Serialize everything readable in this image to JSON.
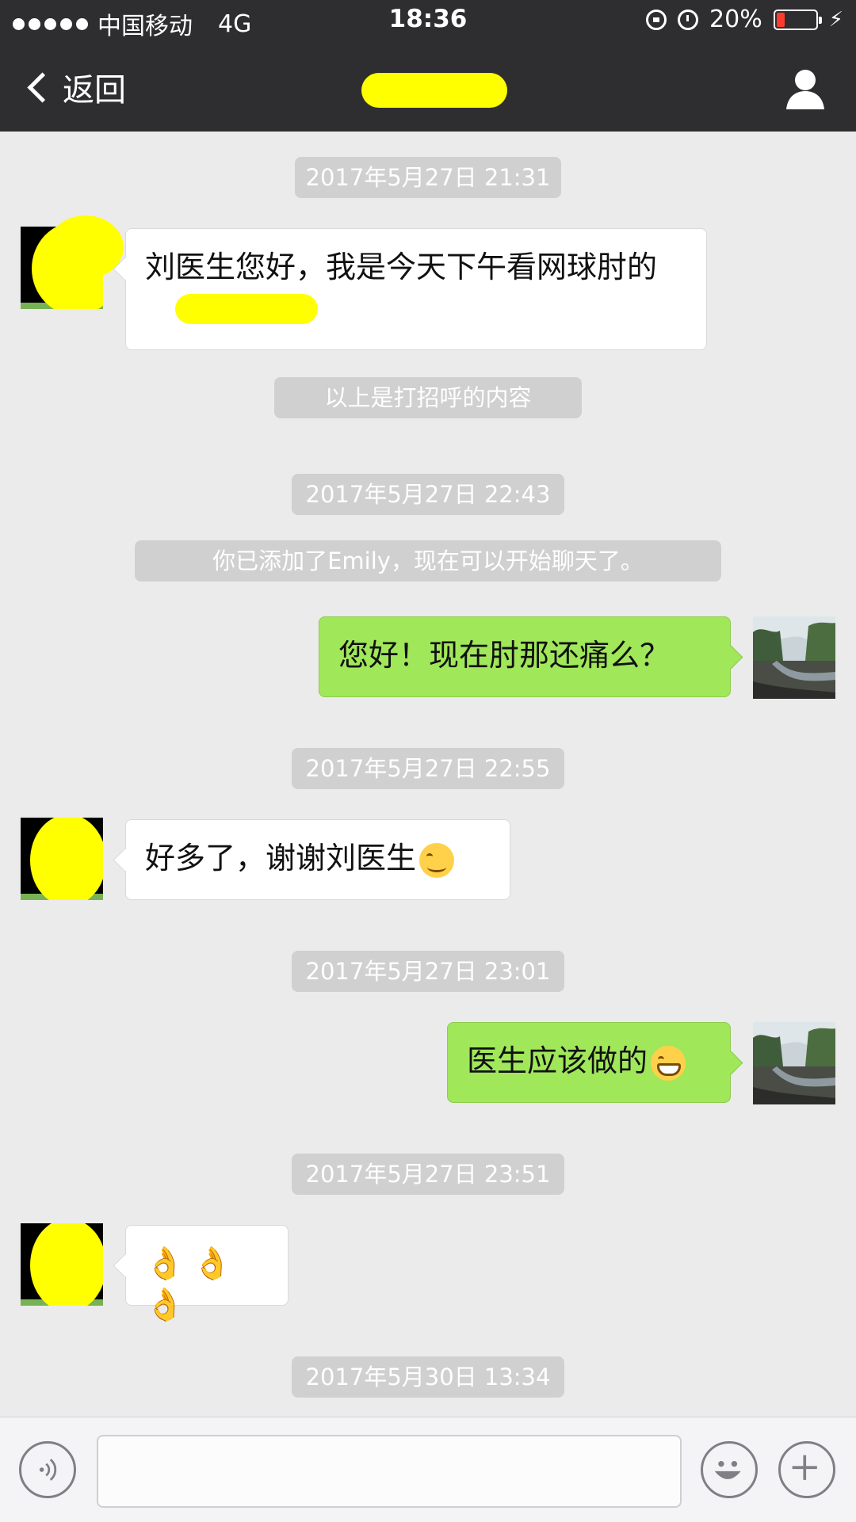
{
  "status_bar": {
    "carrier": "中国移动",
    "network": "4G",
    "time": "18:36",
    "battery_percent": "20%",
    "battery_level": 0.2,
    "icons": [
      "signal-dots-icon",
      "rotation-lock-icon",
      "alarm-icon",
      "battery-icon",
      "charging-bolt-icon"
    ]
  },
  "nav": {
    "back_label": "返回",
    "title": "",
    "profile_icon": "person-icon"
  },
  "messages": [
    {
      "kind": "time",
      "text": "2017年5月27日 21:31"
    },
    {
      "kind": "in",
      "text": "刘医生您好，我是今天下午看网球肘的"
    },
    {
      "kind": "system",
      "text": "以上是打招呼的内容"
    },
    {
      "kind": "time",
      "text": "2017年5月27日 22:43"
    },
    {
      "kind": "system",
      "text": "你已添加了Emily，现在可以开始聊天了。"
    },
    {
      "kind": "out",
      "text": "您好！现在肘那还痛么？"
    },
    {
      "kind": "time",
      "text": "2017年5月27日 22:55"
    },
    {
      "kind": "in",
      "text": "好多了，谢谢刘医生"
    },
    {
      "kind": "time",
      "text": "2017年5月27日 23:01"
    },
    {
      "kind": "out",
      "text": "医生应该做的"
    },
    {
      "kind": "time",
      "text": "2017年5月27日 23:51"
    },
    {
      "kind": "in",
      "text": ""
    },
    {
      "kind": "time",
      "text": "2017年5月30日 13:34"
    }
  ],
  "input_bar": {
    "value": "",
    "icons": [
      "voice-icon",
      "emoji-icon",
      "plus-icon"
    ]
  },
  "colors": {
    "bar_bg": "#2e2e30",
    "chat_bg": "#ebebeb",
    "out_bubble": "#a0e75a",
    "in_bubble": "#ffffff",
    "pill_bg": "#d0d0d0",
    "redaction": "#ffff00"
  }
}
